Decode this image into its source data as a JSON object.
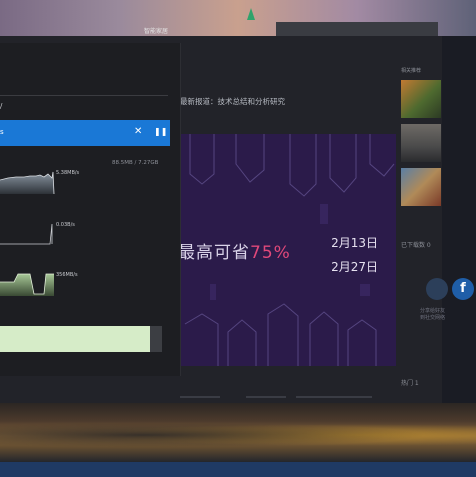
{
  "desktop": {
    "top_text": "智能家居",
    "tree_icon": "christmas-tree-icon"
  },
  "article": {
    "title": "最新报道：技术总结和分析研究",
    "banner": {
      "headline_prefix": "最高可省",
      "headline_pct": "75%",
      "date_start": "2月13日",
      "date_end": "2月27日",
      "bg_color": "#2b1b4a",
      "accent_color": "#e0487a"
    }
  },
  "sidebar": {
    "header": "相关推荐",
    "stat": "已下载数 0",
    "facebook_label": "f",
    "lines": [
      "分享给好友",
      "到社交网络"
    ],
    "mini": "热门 1"
  },
  "download_panel": {
    "section_label": "/",
    "active_item": {
      "label": "s",
      "close_icon": "close-icon",
      "pause_icon": "pause-icon"
    },
    "total": "88.5MB / 7.27GB",
    "graphs": [
      {
        "rate": "5.38MB/s",
        "color": "#6f7a86"
      },
      {
        "rate": "0.03B/s",
        "color": "#9aa0a8"
      },
      {
        "rate": "356MB/s",
        "color": "#6d8f5d"
      }
    ],
    "progress": {
      "fraction": 0.926,
      "color": "#d6ecc8"
    }
  }
}
